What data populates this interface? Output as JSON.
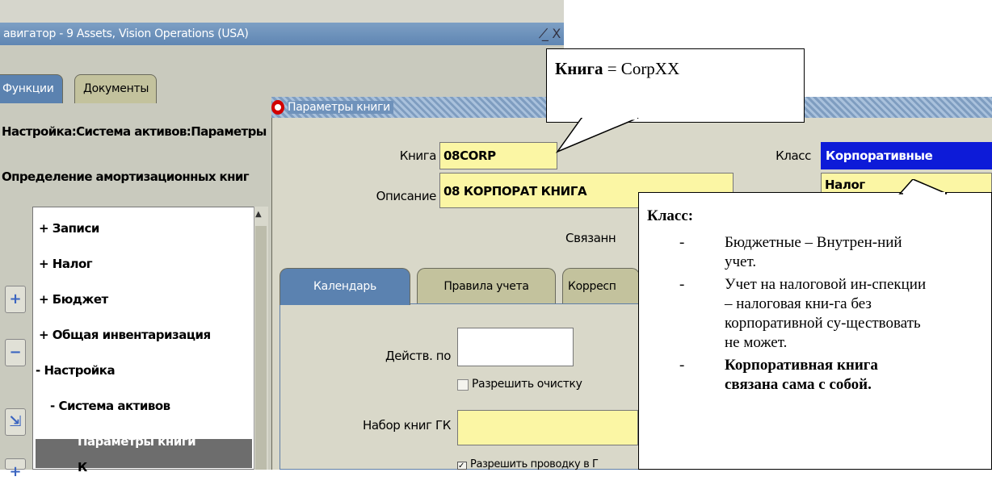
{
  "navigator": {
    "title": "авигатор - 9 Assets, Vision Operations (USA)",
    "controls": "_̸ X",
    "tabs": [
      "Функции",
      "Документы"
    ],
    "path": "Настройка:Система активов:Параметры",
    "subtitle": "Определение амортизационных книг",
    "tree": [
      "+ Записи",
      "+ Налог",
      "+ Бюджет",
      "+ Общая инвентаризация",
      "- Настройка",
      "- Система активов",
      "Параметры книги",
      "К"
    ],
    "side_buttons": [
      "+",
      "−",
      "⇲",
      "+"
    ]
  },
  "book_params": {
    "title": "Параметры книги",
    "book_label": "Книга",
    "book_value": "08CORP",
    "description_label": "Описание",
    "description_value": "08 КОРПОРАТ КНИГА",
    "class_label": "Класс",
    "class_value": "Корпоративные",
    "class_option2": "Налог",
    "associated_label": "Связанн",
    "tabs": [
      "Календарь",
      "Правила учета",
      "Корресп"
    ],
    "effective_label": "Действ. по",
    "effective_value": "",
    "allow_purge_label": "Разрешить очистку",
    "gl_set_label": "Набор книг ГК",
    "gl_set_value": "",
    "allow_posting_label": "Разрешить проводку в Г"
  },
  "callouts": {
    "book_bold": "Книга",
    "book_rest": " = CorpXX",
    "class_title": "Класс:",
    "class_items": [
      "Бюджетные – Внутрен-ний учет.",
      "Учет на налоговой ин-спекции – налоговая кни-га без корпоративной су-ществовать не может.",
      "Корпоративная книга связана сама с собой."
    ]
  }
}
